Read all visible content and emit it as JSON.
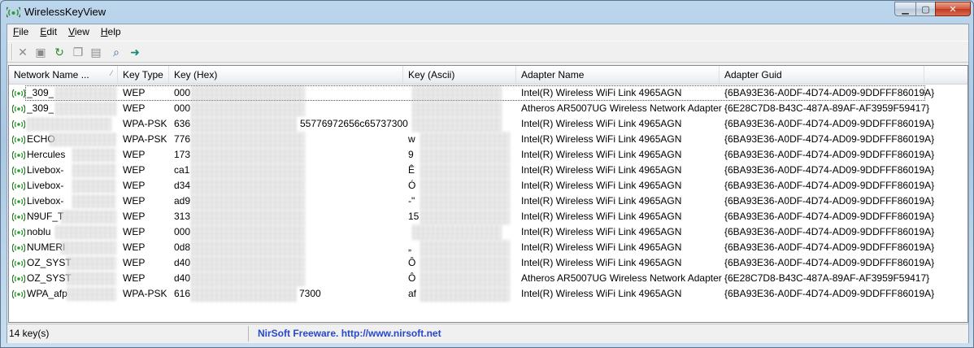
{
  "window": {
    "title": "WirelessKeyView"
  },
  "menu": [
    "File",
    "Edit",
    "View",
    "Help"
  ],
  "toolbar": [
    {
      "name": "delete-icon",
      "glyph": "✕"
    },
    {
      "name": "save-icon",
      "glyph": "▣"
    },
    {
      "name": "refresh-icon",
      "glyph": "↻"
    },
    {
      "name": "copy-icon",
      "glyph": "❐"
    },
    {
      "name": "properties-icon",
      "glyph": "▤"
    },
    {
      "name": "find-icon",
      "glyph": "⌕"
    },
    {
      "name": "exit-icon",
      "glyph": "➜"
    }
  ],
  "columns": [
    "Network Name ...",
    "Key Type",
    "Key (Hex)",
    "Key (Ascii)",
    "Adapter Name",
    "Adapter Guid"
  ],
  "rows": [
    {
      "name": "_309_",
      "type": "WEP",
      "hex": "000",
      "ascii": "",
      "adapter": "Intel(R) Wireless WiFi Link 4965AGN",
      "guid": "{6BA93E36-A0DF-4D74-AD09-9DDFFF86019A}"
    },
    {
      "name": "_309_",
      "type": "WEP",
      "hex": "000",
      "ascii": "",
      "adapter": "Atheros AR5007UG Wireless Network Adapter",
      "guid": "{6E28C7D8-B43C-487A-89AF-AF3959F59417}"
    },
    {
      "name": "",
      "type": "WPA-PSK",
      "hex": "636",
      "hex_tail": "55776972656c65737300",
      "ascii": "",
      "adapter": "Intel(R) Wireless WiFi Link 4965AGN",
      "guid": "{6BA93E36-A0DF-4D74-AD09-9DDFFF86019A}"
    },
    {
      "name": "ECHO",
      "type": "WPA-PSK",
      "hex": "776",
      "ascii": "w",
      "adapter": "Intel(R) Wireless WiFi Link 4965AGN",
      "guid": "{6BA93E36-A0DF-4D74-AD09-9DDFFF86019A}"
    },
    {
      "name": "Hercules",
      "type": "WEP",
      "hex": "173",
      "ascii": "9",
      "adapter": "Intel(R) Wireless WiFi Link 4965AGN",
      "guid": "{6BA93E36-A0DF-4D74-AD09-9DDFFF86019A}"
    },
    {
      "name": "Livebox-",
      "type": "WEP",
      "hex": "ca1",
      "ascii": "Ê",
      "adapter": "Intel(R) Wireless WiFi Link 4965AGN",
      "guid": "{6BA93E36-A0DF-4D74-AD09-9DDFFF86019A}"
    },
    {
      "name": "Livebox-",
      "type": "WEP",
      "hex": "d34",
      "ascii": "Ó",
      "adapter": "Intel(R) Wireless WiFi Link 4965AGN",
      "guid": "{6BA93E36-A0DF-4D74-AD09-9DDFFF86019A}"
    },
    {
      "name": "Livebox-",
      "type": "WEP",
      "hex": "ad9",
      "ascii": "-\"",
      "adapter": "Intel(R) Wireless WiFi Link 4965AGN",
      "guid": "{6BA93E36-A0DF-4D74-AD09-9DDFFF86019A}"
    },
    {
      "name": "N9UF_T",
      "type": "WEP",
      "hex": "313",
      "ascii": "15",
      "adapter": "Intel(R) Wireless WiFi Link 4965AGN",
      "guid": "{6BA93E36-A0DF-4D74-AD09-9DDFFF86019A}"
    },
    {
      "name": "noblu",
      "type": "WEP",
      "hex": "000",
      "ascii": "",
      "adapter": "Intel(R) Wireless WiFi Link 4965AGN",
      "guid": "{6BA93E36-A0DF-4D74-AD09-9DDFFF86019A}"
    },
    {
      "name": "NUMERI",
      "type": "WEP",
      "hex": "0d8",
      "ascii": "„",
      "adapter": "Intel(R) Wireless WiFi Link 4965AGN",
      "guid": "{6BA93E36-A0DF-4D74-AD09-9DDFFF86019A}"
    },
    {
      "name": "OZ_SYST",
      "type": "WEP",
      "hex": "d40",
      "ascii": "Ô",
      "adapter": "Intel(R) Wireless WiFi Link 4965AGN",
      "guid": "{6BA93E36-A0DF-4D74-AD09-9DDFFF86019A}"
    },
    {
      "name": "OZ_SYST",
      "type": "WEP",
      "hex": "d40",
      "ascii": "Ô",
      "adapter": "Atheros AR5007UG Wireless Network Adapter",
      "guid": "{6E28C7D8-B43C-487A-89AF-AF3959F59417}"
    },
    {
      "name": "WPA_afp",
      "type": "WPA-PSK",
      "hex": "616",
      "hex_tail": "7300",
      "ascii": "af",
      "adapter": "Intel(R) Wireless WiFi Link 4965AGN",
      "guid": "{6BA93E36-A0DF-4D74-AD09-9DDFFF86019A}"
    }
  ],
  "status": {
    "count": "14 key(s)",
    "link": "NirSoft Freeware.  http://www.nirsoft.net"
  }
}
